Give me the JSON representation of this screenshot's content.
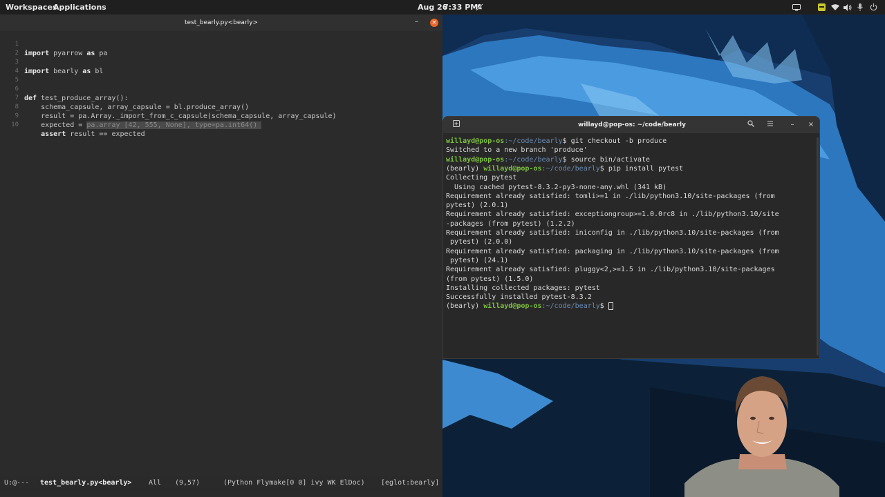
{
  "topbar": {
    "workspaces": "Workspaces",
    "applications": "Applications",
    "date": "Aug 26",
    "time": "7:33 PM",
    "icons": [
      "notifications-muted-icon",
      "screen-icon",
      "keyboard-icon",
      "wifi-icon",
      "volume-icon",
      "microphone-icon",
      "power-icon"
    ]
  },
  "emacs": {
    "title": "test_bearly.py<bearly>",
    "code": [
      {
        "n": "1",
        "kw": "import",
        "rest": " pyarrow ",
        "kw2": "as",
        "rest2": " pa"
      },
      {
        "n": "2",
        "kw": "",
        "rest": "",
        "kw2": "",
        "rest2": ""
      },
      {
        "n": "3",
        "kw": "import",
        "rest": " bearly ",
        "kw2": "as",
        "rest2": " bl"
      },
      {
        "n": "4",
        "kw": "",
        "rest": "",
        "kw2": "",
        "rest2": ""
      },
      {
        "n": "5",
        "kw": "",
        "rest": "",
        "kw2": "",
        "rest2": ""
      },
      {
        "n": "6",
        "kw": "def",
        "rest": " test_produce_array():",
        "kw2": "",
        "rest2": ""
      },
      {
        "n": "7",
        "kw": "",
        "rest": "    schema_capsule, array_capsule = bl.produce_array()",
        "kw2": "",
        "rest2": ""
      },
      {
        "n": "8",
        "kw": "",
        "rest": "    result = pa.Array._import_from_c_capsule(schema_capsule, array_capsule)",
        "kw2": "",
        "rest2": ""
      },
      {
        "n": "9",
        "kw": "",
        "rest": "    expected = ",
        "kw2": "",
        "rest2": "pa.array [42, 555, None], type=pa.int64() "
      },
      {
        "n": "10",
        "kw": "",
        "rest": "    ",
        "kw2": "assert",
        "rest2": " result == expected"
      }
    ],
    "modeline": {
      "state": "U:@---",
      "buffer": "test_bearly.py<bearly>",
      "position": "All",
      "cursor": "(9,57)",
      "modes": "(Python Flymake[0 0] ivy WK ElDoc)",
      "eglot": "[eglot:bearly]"
    }
  },
  "terminal": {
    "title": "willayd@pop-os: ~/code/bearly",
    "lines": [
      {
        "venv": "",
        "user": "willayd@pop-os",
        "path": ":~/code/bearly",
        "text": "$ git checkout -b produce"
      },
      {
        "venv": "",
        "user": "",
        "path": "",
        "text": "Switched to a new branch 'produce'"
      },
      {
        "venv": "",
        "user": "willayd@pop-os",
        "path": ":~/code/bearly",
        "text": "$ source bin/activate"
      },
      {
        "venv": "(bearly) ",
        "user": "willayd@pop-os",
        "path": ":~/code/bearly",
        "text": "$ pip install pytest"
      },
      {
        "venv": "",
        "user": "",
        "path": "",
        "text": "Collecting pytest"
      },
      {
        "venv": "",
        "user": "",
        "path": "",
        "text": "  Using cached pytest-8.3.2-py3-none-any.whl (341 kB)"
      },
      {
        "venv": "",
        "user": "",
        "path": "",
        "text": "Requirement already satisfied: tomli>=1 in ./lib/python3.10/site-packages (from"
      },
      {
        "venv": "",
        "user": "",
        "path": "",
        "text": "pytest) (2.0.1)"
      },
      {
        "venv": "",
        "user": "",
        "path": "",
        "text": "Requirement already satisfied: exceptiongroup>=1.0.0rc8 in ./lib/python3.10/site"
      },
      {
        "venv": "",
        "user": "",
        "path": "",
        "text": "-packages (from pytest) (1.2.2)"
      },
      {
        "venv": "",
        "user": "",
        "path": "",
        "text": "Requirement already satisfied: iniconfig in ./lib/python3.10/site-packages (from"
      },
      {
        "venv": "",
        "user": "",
        "path": "",
        "text": " pytest) (2.0.0)"
      },
      {
        "venv": "",
        "user": "",
        "path": "",
        "text": "Requirement already satisfied: packaging in ./lib/python3.10/site-packages (from"
      },
      {
        "venv": "",
        "user": "",
        "path": "",
        "text": " pytest) (24.1)"
      },
      {
        "venv": "",
        "user": "",
        "path": "",
        "text": "Requirement already satisfied: pluggy<2,>=1.5 in ./lib/python3.10/site-packages"
      },
      {
        "venv": "",
        "user": "",
        "path": "",
        "text": "(from pytest) (1.5.0)"
      },
      {
        "venv": "",
        "user": "",
        "path": "",
        "text": "Installing collected packages: pytest"
      },
      {
        "venv": "",
        "user": "",
        "path": "",
        "text": "Successfully installed pytest-8.3.2"
      },
      {
        "venv": "(bearly) ",
        "user": "willayd@pop-os",
        "path": ":~/code/bearly",
        "text": "$ "
      }
    ]
  },
  "colors": {
    "prompt_user": "#7ec23f",
    "prompt_path": "#6a8bb5",
    "close_button": "#e8672c",
    "wallpaper_blue": "#2f7fc4"
  }
}
